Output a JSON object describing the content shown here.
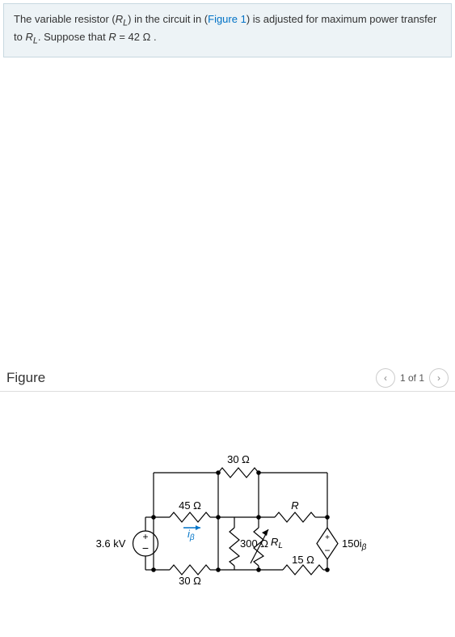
{
  "problem": {
    "sentence_prefix": "The variable resistor (",
    "rl_sym": "R",
    "rl_sub": "L",
    "sentence_mid1": ") in the circuit in (",
    "figure_link": "Figure 1",
    "sentence_mid2": ") is adjusted for maximum power transfer to ",
    "sentence_mid3": ". Suppose that ",
    "r_eq_left": "R",
    "r_eq_eq": " = 42  ",
    "r_eq_unit": "Ω",
    "sentence_end": " ."
  },
  "figure": {
    "title": "Figure",
    "pager_text": "1 of 1"
  },
  "circuit": {
    "source_label": "3.6 kV",
    "r45": "45 Ω",
    "i_beta_sym": "i",
    "i_beta_sub": "β",
    "r30_top": "30 Ω",
    "r300": "300 Ω",
    "rl": "R",
    "rl_sub": "L",
    "r_sym": "R",
    "r30_bot": "30 Ω",
    "r15": "15 Ω",
    "ccvs": "150i",
    "ccvs_sub": "β"
  }
}
